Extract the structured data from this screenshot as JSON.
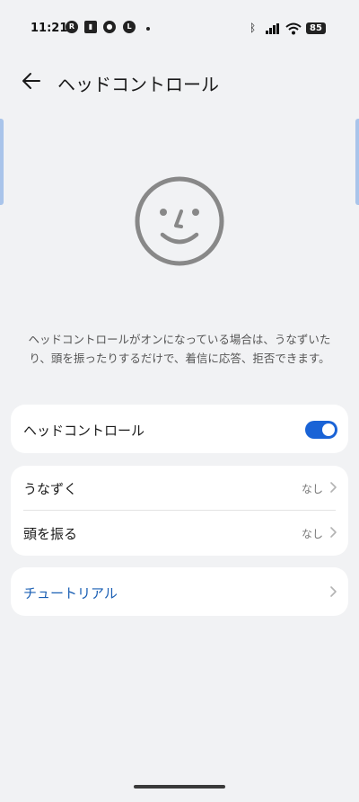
{
  "status_bar": {
    "time": "11:21",
    "battery": "85",
    "notification_icons": [
      "app-r-icon",
      "sim-icon",
      "chat-icon",
      "line-icon"
    ],
    "system_icons": [
      "bluetooth-icon",
      "signal-icon",
      "wifi-icon",
      "battery-icon"
    ]
  },
  "header": {
    "title": "ヘッドコントロール"
  },
  "description": "ヘッドコントロールがオンになっている場合は、うなずいたり、頭を振ったりするだけで、着信に応答、拒否できます。",
  "main_toggle": {
    "label": "ヘッドコントロール",
    "enabled": true
  },
  "gestures": [
    {
      "label": "うなずく",
      "value": "なし"
    },
    {
      "label": "頭を振る",
      "value": "なし"
    }
  ],
  "tutorial": {
    "label": "チュートリアル"
  },
  "colors": {
    "accent": "#1a63d6",
    "link": "#1a5fb4",
    "background": "#f1f2f4",
    "card": "#ffffff"
  }
}
